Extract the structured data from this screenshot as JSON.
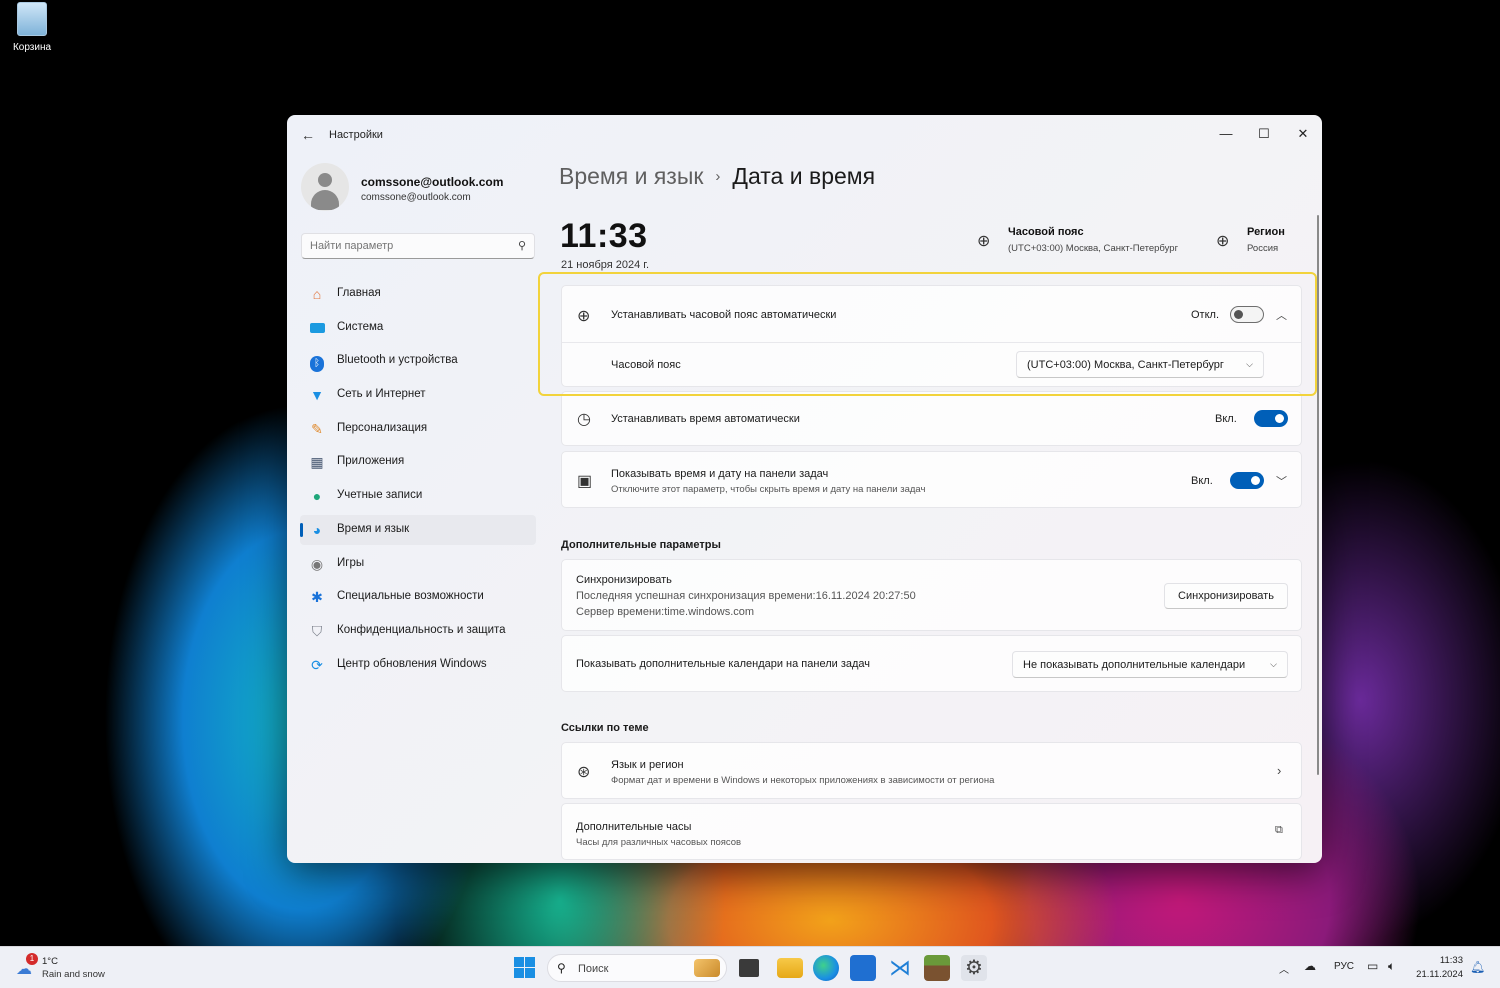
{
  "desktop": {
    "recycle_bin_label": "Корзина"
  },
  "window": {
    "app_title": "Настройки",
    "controls": {
      "minimize": "—",
      "maximize": "☐",
      "close": "✕"
    }
  },
  "profile": {
    "name": "comssone@outlook.com",
    "email": "comssone@outlook.com"
  },
  "search": {
    "placeholder": "Найти параметр"
  },
  "sidebar": {
    "items": [
      {
        "label": "Главная",
        "icon": "home-icon"
      },
      {
        "label": "Система",
        "icon": "system-icon"
      },
      {
        "label": "Bluetooth и устройства",
        "icon": "bluetooth-icon"
      },
      {
        "label": "Сеть и Интернет",
        "icon": "wifi-icon"
      },
      {
        "label": "Персонализация",
        "icon": "brush-icon"
      },
      {
        "label": "Приложения",
        "icon": "apps-icon"
      },
      {
        "label": "Учетные записи",
        "icon": "user-icon"
      },
      {
        "label": "Время и язык",
        "icon": "time-language-icon",
        "active": true
      },
      {
        "label": "Игры",
        "icon": "gamepad-icon"
      },
      {
        "label": "Специальные возможности",
        "icon": "accessibility-icon"
      },
      {
        "label": "Конфиденциальность и защита",
        "icon": "shield-icon"
      },
      {
        "label": "Центр обновления Windows",
        "icon": "update-icon"
      }
    ]
  },
  "breadcrumb": {
    "parent": "Время и язык",
    "separator": "›",
    "current": "Дата и время"
  },
  "header": {
    "time": "11:33",
    "date": "21 ноября 2024 г.",
    "timezone": {
      "title": "Часовой пояс",
      "value": "(UTC+03:00) Москва, Санкт-Петербург"
    },
    "region": {
      "title": "Регион",
      "value": "Россия"
    }
  },
  "settings": {
    "auto_timezone": {
      "label": "Устанавливать часовой пояс автоматически",
      "state_label": "Откл.",
      "enabled": false
    },
    "timezone_select": {
      "label": "Часовой пояс",
      "value": "(UTC+03:00) Москва, Санкт-Петербург"
    },
    "auto_time": {
      "label": "Устанавливать время автоматически",
      "state_label": "Вкл.",
      "enabled": true
    },
    "show_taskbar_time": {
      "label": "Показывать время и дату на панели задач",
      "description": "Отключите этот параметр, чтобы скрыть время и дату на панели задач",
      "state_label": "Вкл.",
      "enabled": true
    }
  },
  "additional": {
    "section_title": "Дополнительные параметры",
    "sync": {
      "title": "Синхронизировать",
      "last_sync": "Последняя успешная синхронизация времени:16.11.2024 20:27:50",
      "server": "Сервер времени:time.windows.com",
      "button_label": "Синхронизировать"
    },
    "calendars": {
      "label": "Показывать дополнительные календари на панели задач",
      "value": "Не показывать дополнительные календари"
    }
  },
  "related": {
    "section_title": "Ссылки по теме",
    "language_region": {
      "title": "Язык и регион",
      "description": "Формат дат и времени в Windows и некоторых приложениях в зависимости от региона"
    },
    "additional_clocks": {
      "title": "Дополнительные часы",
      "description": "Часы для различных часовых поясов"
    }
  },
  "taskbar": {
    "weather": {
      "badge": "1",
      "temp": "1°C",
      "description": "Rain and snow"
    },
    "search_label": "Поиск",
    "language": "РУС",
    "time": "11:33",
    "date": "21.11.2024"
  },
  "colors": {
    "accent": "#005fb8",
    "highlight_box": "#f2d33b"
  }
}
